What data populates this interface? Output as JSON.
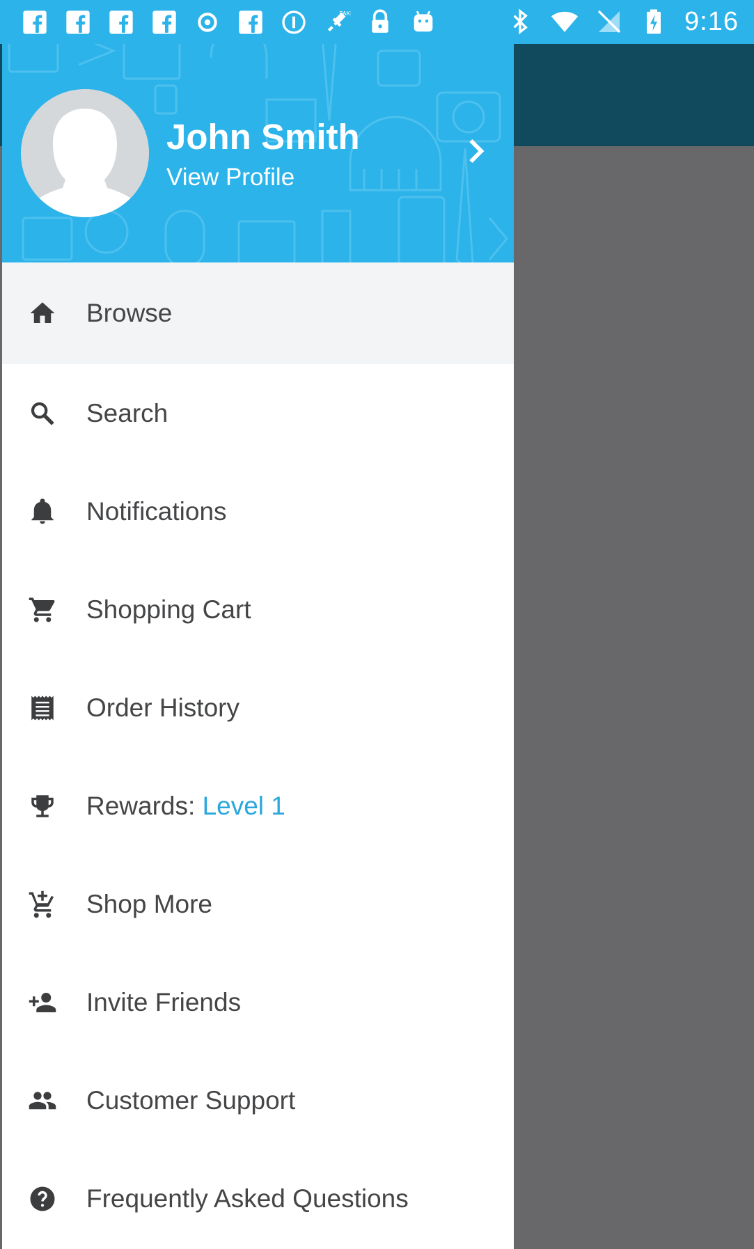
{
  "status_bar": {
    "time": "9:16",
    "left_icons": [
      "facebook-icon",
      "facebook-icon",
      "facebook-icon",
      "facebook-icon",
      "record-icon",
      "facebook-icon",
      "info-icon",
      "fake-gps-satellite-icon",
      "lock-icon",
      "android-icon"
    ],
    "right_icons": [
      "bluetooth-icon",
      "wifi-icon",
      "no-signal-icon",
      "battery-charging-icon"
    ]
  },
  "colors": {
    "header_blue": "#2bb3ea",
    "app_bar_dark_teal": "#124a5d",
    "scrim_gray": "#68686a",
    "active_item_bg": "#f3f4f5",
    "label_text": "#444547",
    "accent_blue": "#2aa7dd"
  },
  "drawer": {
    "header": {
      "user_name": "John Smith",
      "profile_link": "View Profile",
      "chevron_icon": "chevron-right-icon"
    },
    "items": [
      {
        "label": "Browse",
        "icon": "home-icon",
        "active": true
      },
      {
        "label": "Search",
        "icon": "search-icon",
        "active": false
      },
      {
        "label": "Notifications",
        "icon": "bell-icon",
        "active": false
      },
      {
        "label": "Shopping Cart",
        "icon": "cart-icon",
        "active": false
      },
      {
        "label": "Order History",
        "icon": "receipt-icon",
        "active": false
      },
      {
        "label": "Rewards: ",
        "label_accent": "Level 1",
        "icon": "trophy-icon",
        "active": false
      },
      {
        "label": "Shop More",
        "icon": "add-to-cart-icon",
        "active": false
      },
      {
        "label": "Invite Friends",
        "icon": "person-add-icon",
        "active": false
      },
      {
        "label": "Customer Support",
        "icon": "people-icon",
        "active": false
      },
      {
        "label": "Frequently Asked Questions",
        "icon": "help-icon",
        "active": false
      }
    ]
  }
}
